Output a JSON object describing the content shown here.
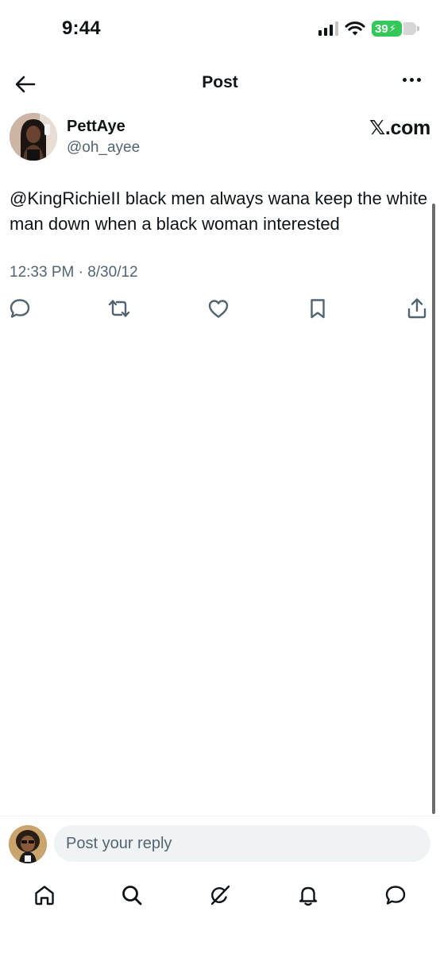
{
  "status_bar": {
    "time": "9:44",
    "battery_level": "39",
    "battery_color": "#34c759",
    "icons": [
      "signal-icon",
      "wifi-icon",
      "battery-icon"
    ]
  },
  "header": {
    "title": "Post",
    "back_icon": "arrow-left-icon",
    "more_icon": "more-horizontal-icon"
  },
  "post": {
    "author": {
      "display_name": "PettAye",
      "handle": "@oh_ayee"
    },
    "watermark": "𝕏.com",
    "text": "@KingRichieII black men always wana keep the white man down when a black woman interested",
    "timestamp": "12:33 PM · 8/30/12",
    "actions": [
      "reply-icon",
      "repost-icon",
      "like-icon",
      "bookmark-icon",
      "share-icon"
    ]
  },
  "reply_bar": {
    "placeholder": "Post your reply"
  },
  "bottom_nav": {
    "items": [
      "home-icon",
      "search-icon",
      "grok-icon",
      "notifications-icon",
      "messages-icon"
    ]
  },
  "colors": {
    "text_primary": "#0f1419",
    "text_secondary": "#536471",
    "input_bg": "#eff3f4"
  }
}
